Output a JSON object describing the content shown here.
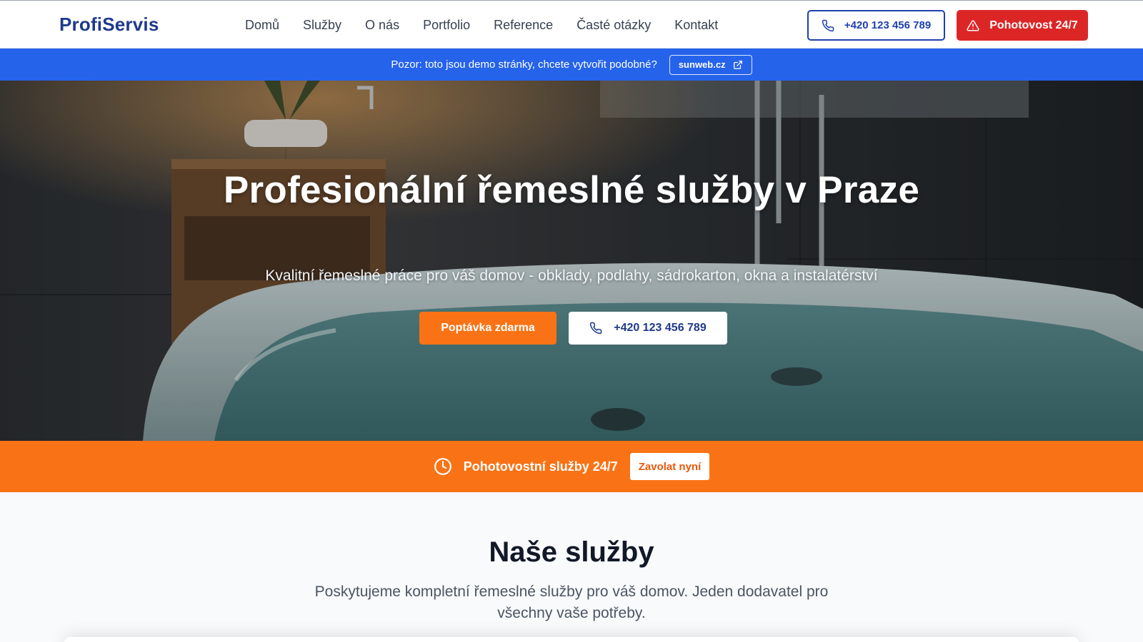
{
  "header": {
    "logo": "ProfiServis",
    "nav": [
      "Domů",
      "Služby",
      "O nás",
      "Portfolio",
      "Reference",
      "Časté otázky",
      "Kontakt"
    ],
    "phone_label": "+420 123 456 789",
    "emergency_label": "Pohotovost 24/7",
    "icons": {
      "phone": "phone-icon",
      "emergency": "warning-triangle-icon"
    }
  },
  "notice": {
    "text": "Pozor: toto jsou demo stránky, chcete vytvořit podobné?",
    "link_label": "sunweb.cz",
    "link_icon": "external-link-icon"
  },
  "hero": {
    "title": "Profesionální řemeslné služby v Praze",
    "subtitle": "Kvalitní řemeslné práce pro váš domov - obklady, podlahy, sádrokarton, okna a instalatérství",
    "primary_button": "Poptávka zdarma",
    "phone_button": "+420 123 456 789"
  },
  "emergency_strip": {
    "text": "Pohotovostní služby 24/7",
    "button": "Zavolat nyní",
    "icon": "clock-icon"
  },
  "services": {
    "title": "Naše služby",
    "description": "Poskytujeme kompletní řemeslné služby pro váš domov. Jeden dodavatel pro všechny vaše potřeby."
  },
  "colors": {
    "brand_blue": "#1e3a8a",
    "notice_blue": "#2563eb",
    "emergency_red": "#dc2626",
    "accent_orange": "#f97316"
  }
}
